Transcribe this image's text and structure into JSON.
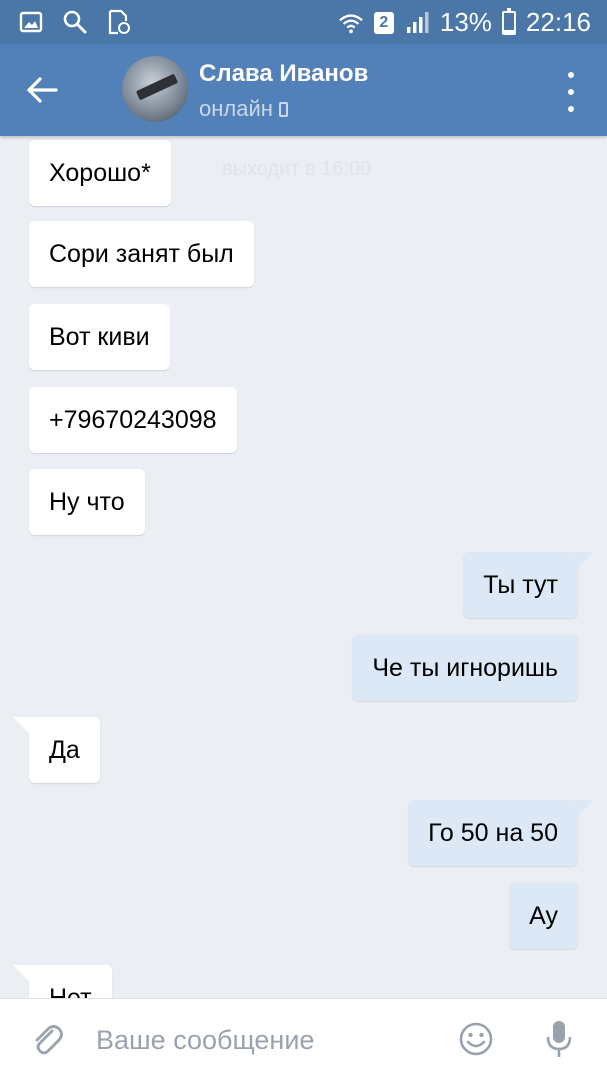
{
  "status_bar": {
    "icons_left": [
      "gallery-icon",
      "search-icon",
      "file-sync-icon"
    ],
    "sim_slot": "2",
    "battery": "13%",
    "battery_level": 0.13,
    "time": "22:16"
  },
  "header": {
    "contact_name": "Слава Иванов",
    "contact_status": "онлайн",
    "colors": {
      "bar": "#5181b8",
      "status_bar": "#4a76a8"
    }
  },
  "chat": {
    "ghost_text": "выходит в 16:00",
    "messages": [
      {
        "direction": "incoming",
        "text": "Хорошо*"
      },
      {
        "direction": "incoming",
        "text": "Сори занят был"
      },
      {
        "direction": "incoming",
        "text": "Вот киви"
      },
      {
        "direction": "incoming",
        "text": "+79670243098"
      },
      {
        "direction": "incoming",
        "text": "Ну что"
      },
      {
        "direction": "outgoing",
        "text": "Ты тут"
      },
      {
        "direction": "outgoing",
        "text": "Че ты игноришь"
      },
      {
        "direction": "incoming",
        "text": "Да"
      },
      {
        "direction": "outgoing",
        "text": "Го 50 на 50"
      },
      {
        "direction": "outgoing",
        "text": "Ау"
      },
      {
        "direction": "incoming",
        "text": "Нет"
      }
    ],
    "colors": {
      "incoming": "#ffffff",
      "outgoing": "#dce8f5",
      "background": "#ebeff4"
    }
  },
  "composer": {
    "placeholder": "Ваше сообщение",
    "icons": [
      "paperclip-icon",
      "emoji-icon",
      "microphone-icon"
    ]
  }
}
